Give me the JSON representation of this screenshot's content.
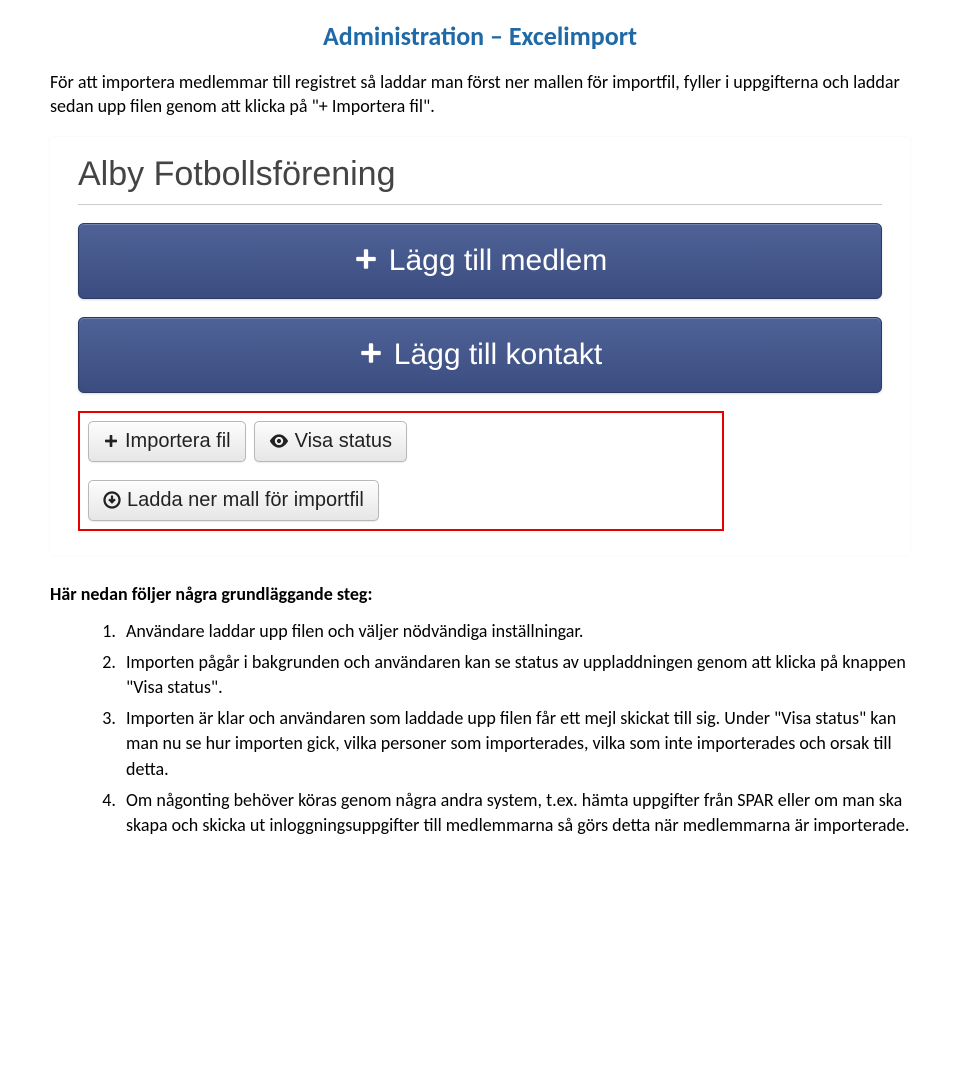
{
  "title": "Administration – Excelimport",
  "intro": "För att importera medlemmar till registret så laddar man först ner mallen för importfil, fyller i uppgifterna och laddar sedan upp filen genom att klicka på \"+ Importera fil\".",
  "panel": {
    "org_name": "Alby Fotbollsförening",
    "add_member_label": "Lägg till medlem",
    "add_contact_label": "Lägg till kontakt",
    "import_fil_label": "Importera fil",
    "visa_status_label": "Visa status",
    "ladda_ner_label": "Ladda ner mall för importfil"
  },
  "steps_lead": "Här nedan följer några grundläggande steg:",
  "steps": [
    "Användare laddar upp filen och väljer nödvändiga inställningar.",
    "Importen pågår i bakgrunden och användaren kan se status av uppladdningen genom att klicka på knappen \"Visa status\".",
    "Importen är klar och användaren som laddade upp filen får ett mejl skickat till sig. Under \"Visa status\" kan man nu se hur importen gick, vilka personer som importerades, vilka som inte importerades och orsak till detta.",
    "Om någonting behöver köras genom några andra system, t.ex. hämta uppgifter från SPAR eller om man ska skapa och skicka ut inloggningsuppgifter till medlemmarna så görs detta när medlemmarna är importerade."
  ]
}
